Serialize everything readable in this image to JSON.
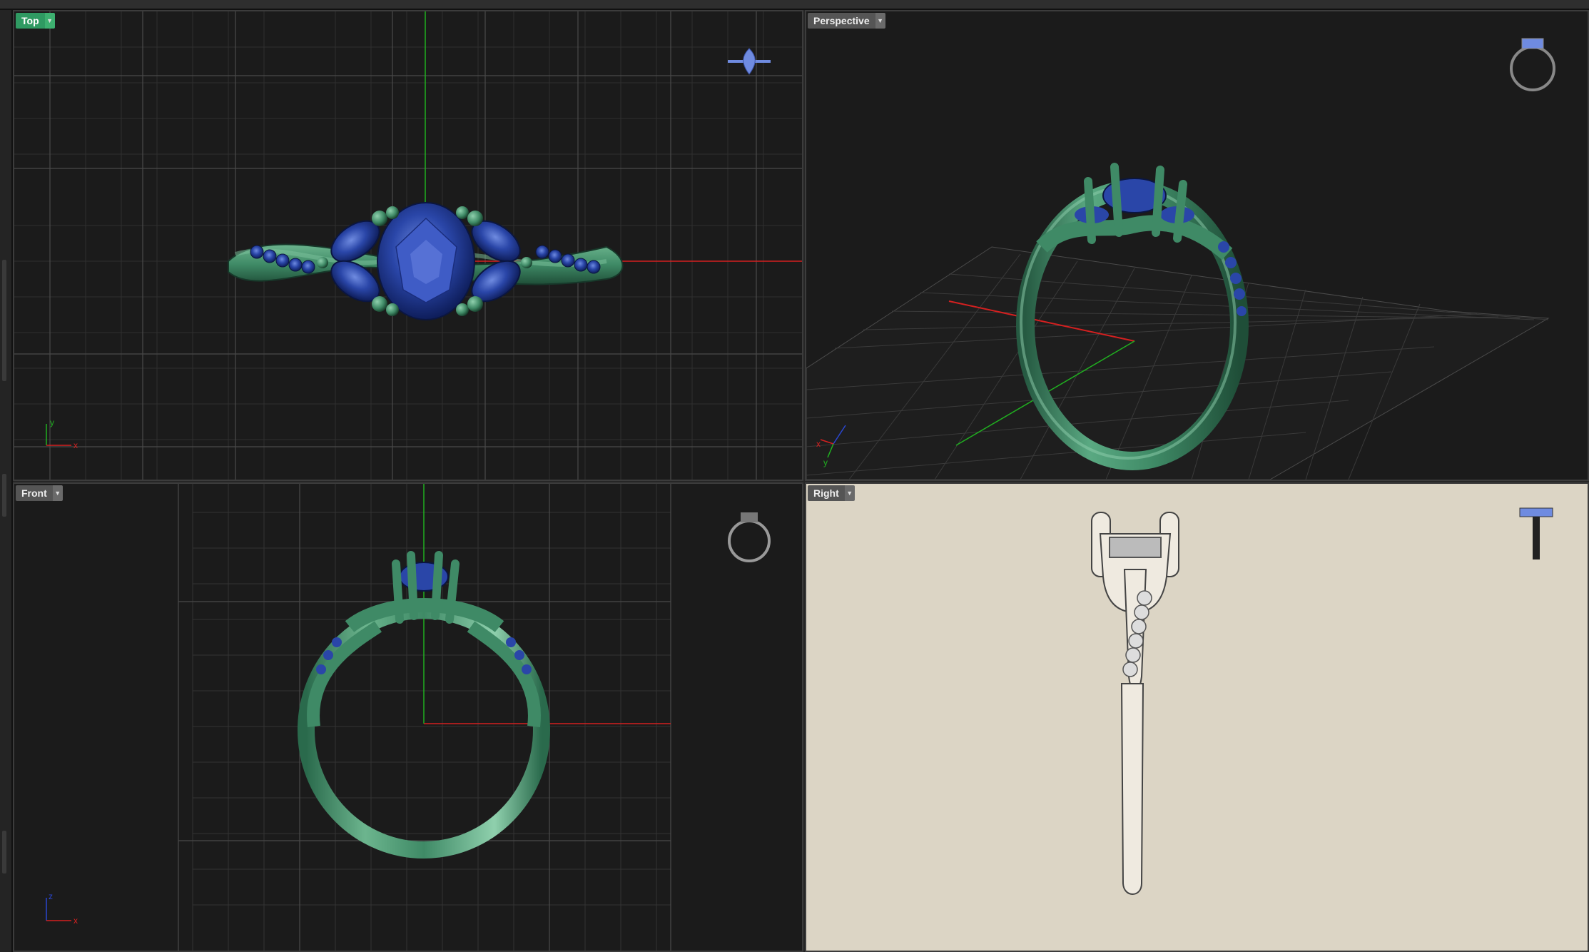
{
  "viewports": {
    "top": {
      "label": "Top",
      "active": true,
      "axis_x": "x",
      "axis_y": "y"
    },
    "perspective": {
      "label": "Perspective",
      "active": false,
      "axis_x": "x",
      "axis_y": "y"
    },
    "front": {
      "label": "Front",
      "active": false,
      "axis_x": "x",
      "axis_z": "z"
    },
    "right": {
      "label": "Right",
      "active": false
    }
  },
  "icons": {
    "viewport_menu": "chevron-down-icon",
    "nav_widget": "ring-thumbnail-icon"
  },
  "colors": {
    "background": "#1b1b1b",
    "grid": "#3a3a3a",
    "x_axis": "#d42020",
    "y_axis": "#20b020",
    "ring_metal": "#3f8a66",
    "gemstone": "#2a46a8",
    "right_view_paper": "#dcd5c5",
    "active_label": "#2f9a62"
  }
}
